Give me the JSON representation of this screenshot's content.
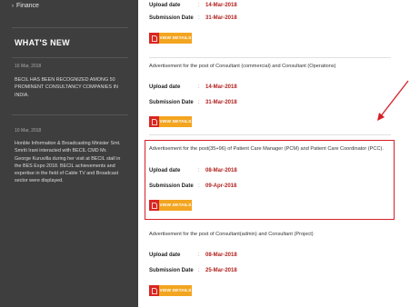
{
  "sidebar": {
    "finance_label": "Finance",
    "whats_new_title": "WHAT'S NEW",
    "news": [
      {
        "date": "16 Mar, 2018",
        "text": "BECIL HAS BEEN RECOGNIZED AMONG 50 PROMINENT CONSULTANCY COMPANIES IN INDIA."
      },
      {
        "date": "10 Mar, 2018",
        "text": "Honble Information & Broadcasting Minister Smt. Smriti Irani interacted with BECIL CMD Mr. George Kuruvilla during her visit at BECIL stall in the BES Expo 2018. BECIL achievements and expertise in the field of Cable TV and Broadcast sector were displayed."
      }
    ]
  },
  "labels": {
    "upload": "Upload date",
    "submission": "Submission Date",
    "colon": ":",
    "view_details": "VIEW DETAILS"
  },
  "items": [
    {
      "title": "",
      "upload": "14-Mar-2018",
      "submission": "31-Mar-2018"
    },
    {
      "title": "Advertisement for the post of Consultant (commercial) and Consultant (Operations)",
      "upload": "14-Mar-2018",
      "submission": "31-Mar-2018"
    },
    {
      "title": "Advertisement for the post(35+96) of Patient Care Manager (PCM) and Patient Care Coordinator (PCC).",
      "upload": "08-Mar-2018",
      "submission": "09-Apr-2018"
    },
    {
      "title": "Advertisement for the post of Consultant(admin) and Consultant (Project)",
      "upload": "08-Mar-2018",
      "submission": "25-Mar-2018"
    }
  ],
  "colors": {
    "sidebar_bg": "#3e3e3e",
    "date_red": "#b0211e",
    "button_orange": "#f3a520",
    "button_icon_red": "#d92622",
    "highlight_red": "#d51f26"
  }
}
